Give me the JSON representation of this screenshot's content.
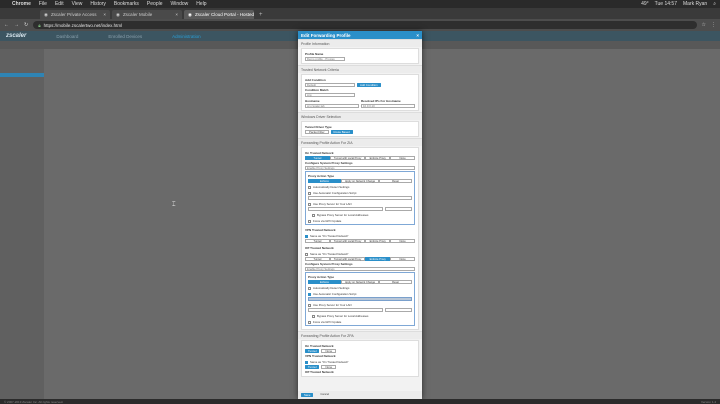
{
  "menubar": {
    "app": "Chrome",
    "items": [
      "File",
      "Edit",
      "View",
      "History",
      "Bookmarks",
      "People",
      "Window",
      "Help"
    ],
    "clock": "Tue 14:57",
    "user": "Mark Ryan",
    "battery": "49°",
    "temp": "49°"
  },
  "tabs": [
    {
      "label": "Zscaler Private Access",
      "active": false
    },
    {
      "label": "Zscaler Mobile",
      "active": false
    },
    {
      "label": "Zscaler Cloud Portal - Hosted",
      "active": true
    }
  ],
  "address": {
    "url": "https://mobile.zscalertwo.net/index.html"
  },
  "app": {
    "logo": "zscaler",
    "nav": [
      "Dashboard",
      "Enrolled Devices",
      "Administration"
    ]
  },
  "modal": {
    "title": "Edit Forwarding Profile",
    "profile_section": "Profile Information",
    "profile_name_label": "Profile Name",
    "profile_name_value": "Demo profile - Proxies",
    "trusted_section": "Trusted Network Criteria",
    "add_condition_label": "Add Condition",
    "add_condition_value": "Default",
    "add_condition_btn": "Add Condition",
    "condition_match_label": "Condition Match",
    "condition_match_value": "Any",
    "hostname_label": "Hostname",
    "hostname_value": "srv.zscaler.lab",
    "resolved_ip_label": "Resolved IPs For Hostname",
    "resolved_ip_value": "10.0.0.10",
    "windows_section": "Windows Driver Selection",
    "tunnel_driver_label": "Tunnel Driver Type",
    "tunnel_driver_options": [
      "Packet Filter",
      "Route Based"
    ],
    "zia_section": "Forwarding Profile Action For ZIA",
    "on_trusted_label": "On Trusted Network",
    "action_options": [
      "Tunnel",
      "Tunnel with Local Proxy",
      "Enforce Proxy",
      "None"
    ],
    "configure_proxy_label": "Configure System Proxy Settings",
    "configure_proxy_value": "Enable Proxy Settings",
    "proxy_action_label": "Proxy Action Type",
    "proxy_action_options": [
      "Enforce",
      "Apply on Network Change",
      "Reset"
    ],
    "auto_detect": "Automatically Detect Settings",
    "use_pac": "Use Automatic Configuration Script",
    "use_proxy": "Use Proxy Server for Your LAN",
    "bypass": "Bypass Proxy Server for Local Addresses",
    "force_gpo": "Force via GPO Update",
    "vpn_label": "VPN Trusted Network",
    "same_as_trusted": "Same as \"On Trusted Network\"",
    "off_trusted_label": "Off Trusted Network",
    "zpa_section": "Forwarding Profile Action For ZPA",
    "zpa_options": [
      "Tunnel",
      "None"
    ],
    "save_btn": "Save",
    "cancel_btn": "Cancel"
  },
  "status": {
    "left": "© 2007-2019 Zscaler Inc. All rights reserved.",
    "right": "Version 1.4"
  }
}
